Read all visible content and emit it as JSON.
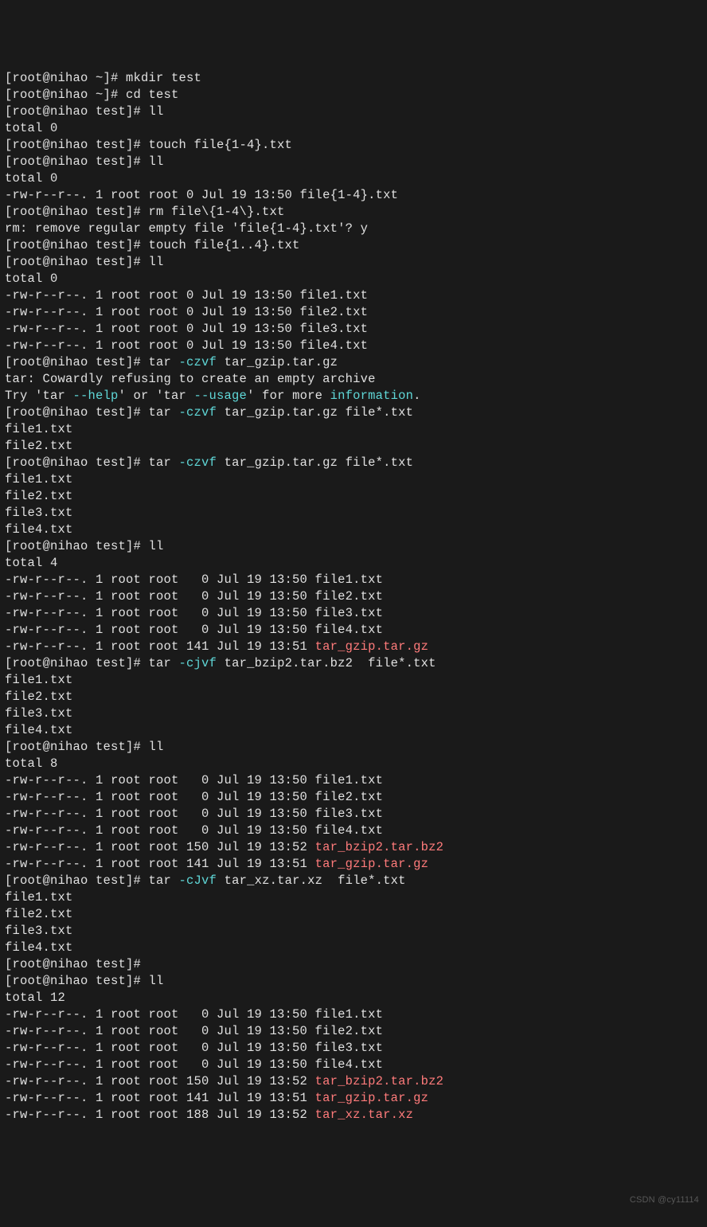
{
  "watermark": "CSDN @cy11114",
  "lines": [
    {
      "segs": [
        {
          "t": "[root@nihao ~]# mkdir test"
        }
      ]
    },
    {
      "segs": [
        {
          "t": "[root@nihao ~]# cd test"
        }
      ]
    },
    {
      "segs": [
        {
          "t": "[root@nihao test]# ll"
        }
      ]
    },
    {
      "segs": [
        {
          "t": "total 0"
        }
      ]
    },
    {
      "segs": [
        {
          "t": "[root@nihao test]# touch file{1-4}.txt"
        }
      ]
    },
    {
      "segs": [
        {
          "t": "[root@nihao test]# ll"
        }
      ]
    },
    {
      "segs": [
        {
          "t": "total 0"
        }
      ]
    },
    {
      "segs": [
        {
          "t": "-rw-r--r--. 1 root root 0 Jul 19 13:50 file{1-4}.txt"
        }
      ]
    },
    {
      "segs": [
        {
          "t": "[root@nihao test]# rm file\\{1-4\\}.txt"
        }
      ]
    },
    {
      "segs": [
        {
          "t": "rm: remove regular empty file 'file{1-4}.txt'? y"
        }
      ]
    },
    {
      "segs": [
        {
          "t": "[root@nihao test]# touch file{1..4}.txt"
        }
      ]
    },
    {
      "segs": [
        {
          "t": "[root@nihao test]# ll"
        }
      ]
    },
    {
      "segs": [
        {
          "t": "total 0"
        }
      ]
    },
    {
      "segs": [
        {
          "t": "-rw-r--r--. 1 root root 0 Jul 19 13:50 file1.txt"
        }
      ]
    },
    {
      "segs": [
        {
          "t": "-rw-r--r--. 1 root root 0 Jul 19 13:50 file2.txt"
        }
      ]
    },
    {
      "segs": [
        {
          "t": "-rw-r--r--. 1 root root 0 Jul 19 13:50 file3.txt"
        }
      ]
    },
    {
      "segs": [
        {
          "t": "-rw-r--r--. 1 root root 0 Jul 19 13:50 file4.txt"
        }
      ]
    },
    {
      "segs": [
        {
          "t": "[root@nihao test]# tar "
        },
        {
          "t": "-czvf",
          "c": "cyan"
        },
        {
          "t": " tar_gzip.tar.gz"
        }
      ]
    },
    {
      "segs": [
        {
          "t": "tar: Cowardly refusing to create an empty archive"
        }
      ]
    },
    {
      "segs": [
        {
          "t": "Try 'tar "
        },
        {
          "t": "--help",
          "c": "cyan"
        },
        {
          "t": "' or 'tar "
        },
        {
          "t": "--usage",
          "c": "cyan"
        },
        {
          "t": "' for more "
        },
        {
          "t": "information",
          "c": "cyan"
        },
        {
          "t": "."
        }
      ]
    },
    {
      "segs": [
        {
          "t": "[root@nihao test]# tar "
        },
        {
          "t": "-czvf",
          "c": "cyan"
        },
        {
          "t": " tar_gzip.tar.gz file*.txt"
        }
      ]
    },
    {
      "segs": [
        {
          "t": "file1.txt"
        }
      ]
    },
    {
      "segs": [
        {
          "t": "file2.txt"
        }
      ]
    },
    {
      "segs": [
        {
          "t": "[root@nihao test]# tar "
        },
        {
          "t": "-czvf",
          "c": "cyan"
        },
        {
          "t": " tar_gzip.tar.gz file*.txt"
        }
      ]
    },
    {
      "segs": [
        {
          "t": "file1.txt"
        }
      ]
    },
    {
      "segs": [
        {
          "t": "file2.txt"
        }
      ]
    },
    {
      "segs": [
        {
          "t": "file3.txt"
        }
      ]
    },
    {
      "segs": [
        {
          "t": "file4.txt"
        }
      ]
    },
    {
      "segs": [
        {
          "t": "[root@nihao test]# ll"
        }
      ]
    },
    {
      "segs": [
        {
          "t": "total 4"
        }
      ]
    },
    {
      "segs": [
        {
          "t": "-rw-r--r--. 1 root root   0 Jul 19 13:50 file1.txt"
        }
      ]
    },
    {
      "segs": [
        {
          "t": "-rw-r--r--. 1 root root   0 Jul 19 13:50 file2.txt"
        }
      ]
    },
    {
      "segs": [
        {
          "t": "-rw-r--r--. 1 root root   0 Jul 19 13:50 file3.txt"
        }
      ]
    },
    {
      "segs": [
        {
          "t": "-rw-r--r--. 1 root root   0 Jul 19 13:50 file4.txt"
        }
      ]
    },
    {
      "segs": [
        {
          "t": "-rw-r--r--. 1 root root 141 Jul 19 13:51 "
        },
        {
          "t": "tar_gzip.tar.gz",
          "c": "red"
        }
      ]
    },
    {
      "segs": [
        {
          "t": "[root@nihao test]# tar "
        },
        {
          "t": "-cjvf",
          "c": "cyan"
        },
        {
          "t": " tar_bzip2.tar.bz2  file*.txt"
        }
      ]
    },
    {
      "segs": [
        {
          "t": "file1.txt"
        }
      ]
    },
    {
      "segs": [
        {
          "t": "file2.txt"
        }
      ]
    },
    {
      "segs": [
        {
          "t": "file3.txt"
        }
      ]
    },
    {
      "segs": [
        {
          "t": "file4.txt"
        }
      ]
    },
    {
      "segs": [
        {
          "t": "[root@nihao test]# ll"
        }
      ]
    },
    {
      "segs": [
        {
          "t": "total 8"
        }
      ]
    },
    {
      "segs": [
        {
          "t": "-rw-r--r--. 1 root root   0 Jul 19 13:50 file1.txt"
        }
      ]
    },
    {
      "segs": [
        {
          "t": "-rw-r--r--. 1 root root   0 Jul 19 13:50 file2.txt"
        }
      ]
    },
    {
      "segs": [
        {
          "t": "-rw-r--r--. 1 root root   0 Jul 19 13:50 file3.txt"
        }
      ]
    },
    {
      "segs": [
        {
          "t": "-rw-r--r--. 1 root root   0 Jul 19 13:50 file4.txt"
        }
      ]
    },
    {
      "segs": [
        {
          "t": "-rw-r--r--. 1 root root 150 Jul 19 13:52 "
        },
        {
          "t": "tar_bzip2.tar.bz2",
          "c": "red"
        }
      ]
    },
    {
      "segs": [
        {
          "t": "-rw-r--r--. 1 root root 141 Jul 19 13:51 "
        },
        {
          "t": "tar_gzip.tar.gz",
          "c": "red"
        }
      ]
    },
    {
      "segs": [
        {
          "t": "[root@nihao test]# tar "
        },
        {
          "t": "-cJvf",
          "c": "cyan"
        },
        {
          "t": " tar_xz.tar.xz  file*.txt"
        }
      ]
    },
    {
      "segs": [
        {
          "t": "file1.txt"
        }
      ]
    },
    {
      "segs": [
        {
          "t": "file2.txt"
        }
      ]
    },
    {
      "segs": [
        {
          "t": "file3.txt"
        }
      ]
    },
    {
      "segs": [
        {
          "t": "file4.txt"
        }
      ]
    },
    {
      "segs": [
        {
          "t": "[root@nihao test]#"
        }
      ]
    },
    {
      "segs": [
        {
          "t": "[root@nihao test]# ll"
        }
      ]
    },
    {
      "segs": [
        {
          "t": "total 12"
        }
      ]
    },
    {
      "segs": [
        {
          "t": "-rw-r--r--. 1 root root   0 Jul 19 13:50 file1.txt"
        }
      ]
    },
    {
      "segs": [
        {
          "t": "-rw-r--r--. 1 root root   0 Jul 19 13:50 file2.txt"
        }
      ]
    },
    {
      "segs": [
        {
          "t": "-rw-r--r--. 1 root root   0 Jul 19 13:50 file3.txt"
        }
      ]
    },
    {
      "segs": [
        {
          "t": "-rw-r--r--. 1 root root   0 Jul 19 13:50 file4.txt"
        }
      ]
    },
    {
      "segs": [
        {
          "t": "-rw-r--r--. 1 root root 150 Jul 19 13:52 "
        },
        {
          "t": "tar_bzip2.tar.bz2",
          "c": "red"
        }
      ]
    },
    {
      "segs": [
        {
          "t": "-rw-r--r--. 1 root root 141 Jul 19 13:51 "
        },
        {
          "t": "tar_gzip.tar.gz",
          "c": "red"
        }
      ]
    },
    {
      "segs": [
        {
          "t": "-rw-r--r--. 1 root root 188 Jul 19 13:52 "
        },
        {
          "t": "tar_xz.tar.xz",
          "c": "red"
        }
      ]
    }
  ]
}
